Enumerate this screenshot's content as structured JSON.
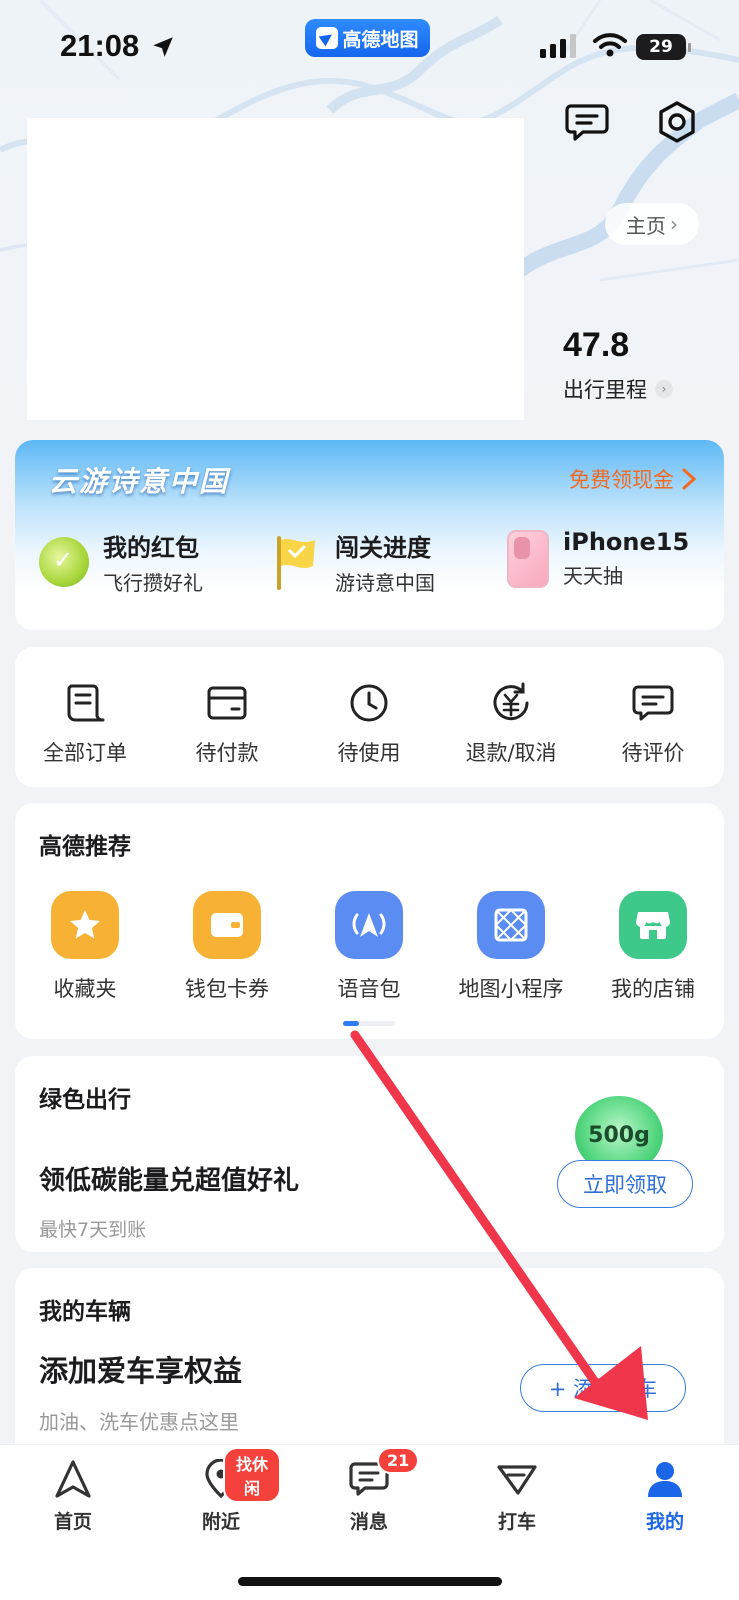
{
  "status_bar": {
    "time": "21:08",
    "battery": "29",
    "app_pill": "高德地图"
  },
  "header": {
    "home_label": "主页",
    "mileage_value": "47.8",
    "mileage_label": "出行里程"
  },
  "promo": {
    "title": "云游诗意中国",
    "cta": "免费领现金",
    "items": [
      {
        "main": "我的红包",
        "sub": "飞行攒好礼",
        "icon": "coin-icon"
      },
      {
        "main": "闯关进度",
        "sub": "游诗意中国",
        "icon": "flag-icon"
      },
      {
        "main": "iPhone15",
        "sub": "天天抽",
        "icon": "phone-icon"
      }
    ]
  },
  "orders": [
    {
      "label": "全部订单",
      "icon": "order-list-icon"
    },
    {
      "label": "待付款",
      "icon": "wallet-icon"
    },
    {
      "label": "待使用",
      "icon": "clock-icon"
    },
    {
      "label": "退款/取消",
      "icon": "refund-icon"
    },
    {
      "label": "待评价",
      "icon": "comment-icon"
    }
  ],
  "recommend": {
    "title": "高德推荐",
    "items": [
      {
        "label": "收藏夹",
        "icon": "star-icon",
        "color": "#f7b134"
      },
      {
        "label": "钱包卡券",
        "icon": "wallet-card-icon",
        "color": "#f7b134"
      },
      {
        "label": "语音包",
        "icon": "voice-icon",
        "color": "#5b8cf2"
      },
      {
        "label": "地图小程序",
        "icon": "mini-program-icon",
        "color": "#5b8cf2"
      },
      {
        "label": "我的店铺",
        "icon": "shop-icon",
        "color": "#3ec98a"
      }
    ]
  },
  "green_travel": {
    "title": "绿色出行",
    "headline": "领低碳能量兑超值好礼",
    "sub": "最快7天到账",
    "energy": "500g",
    "button": "立即领取"
  },
  "vehicle": {
    "title": "我的车辆",
    "headline": "添加爱车享权益",
    "sub": "加油、洗车优惠点这里",
    "button": "+ 添加爱车"
  },
  "tabs": [
    {
      "label": "首页",
      "icon": "navigate-icon",
      "active": false
    },
    {
      "label": "附近",
      "icon": "location-pin-icon",
      "badge": "找休闲",
      "active": false
    },
    {
      "label": "消息",
      "icon": "message-icon",
      "badge": "21",
      "active": false
    },
    {
      "label": "打车",
      "icon": "taxi-icon",
      "active": false
    },
    {
      "label": "我的",
      "icon": "person-icon",
      "active": true
    }
  ],
  "colors": {
    "accent": "#1b66e8",
    "promo_cta": "#f26a21",
    "badge": "#f4413b",
    "annotation_arrow": "#f0364a"
  }
}
